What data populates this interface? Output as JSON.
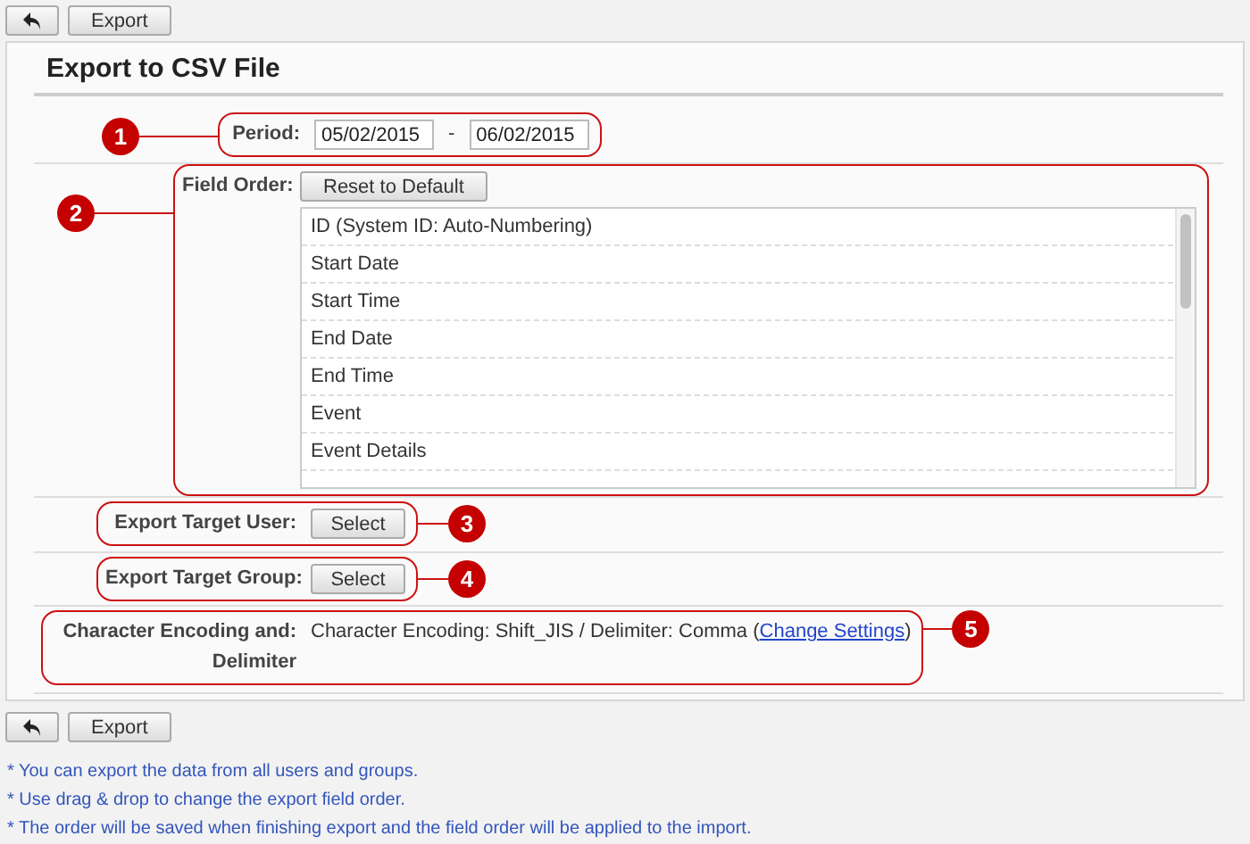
{
  "toolbar_top": {
    "export_button": "Export"
  },
  "panel": {
    "title": "Export to CSV File",
    "rows": [
      {
        "kind": "period",
        "label": "Period:",
        "callout": "1",
        "start_date": "05/02/2015",
        "separator": "-",
        "end_date": "06/02/2015"
      },
      {
        "kind": "field_order",
        "label": "Field Order:",
        "callout": "2",
        "button": "Reset to Default",
        "fields": [
          "ID (System ID: Auto-Numbering)",
          "Start Date",
          "Start Time",
          "End Date",
          "End Time",
          "Event",
          "Event Details"
        ]
      },
      {
        "kind": "select",
        "label": "Export Target User:",
        "callout": "3",
        "button": "Select"
      },
      {
        "kind": "select",
        "label": "Export Target Group:",
        "callout": "4",
        "button": "Select"
      },
      {
        "kind": "encoding",
        "label": "Character Encoding and: Delimiter",
        "callout": "5",
        "text": "Character Encoding: Shift_JIS / Delimiter: Comma (",
        "link": "Change Settings",
        "text_end": ")"
      }
    ]
  },
  "toolbar_bottom": {
    "export_button": "Export"
  },
  "notes": [
    "* You can export the data from all users and groups.",
    "* Use drag & drop to change the export field order.",
    "* The order will be saved when finishing export and the field order will be applied to the import."
  ]
}
